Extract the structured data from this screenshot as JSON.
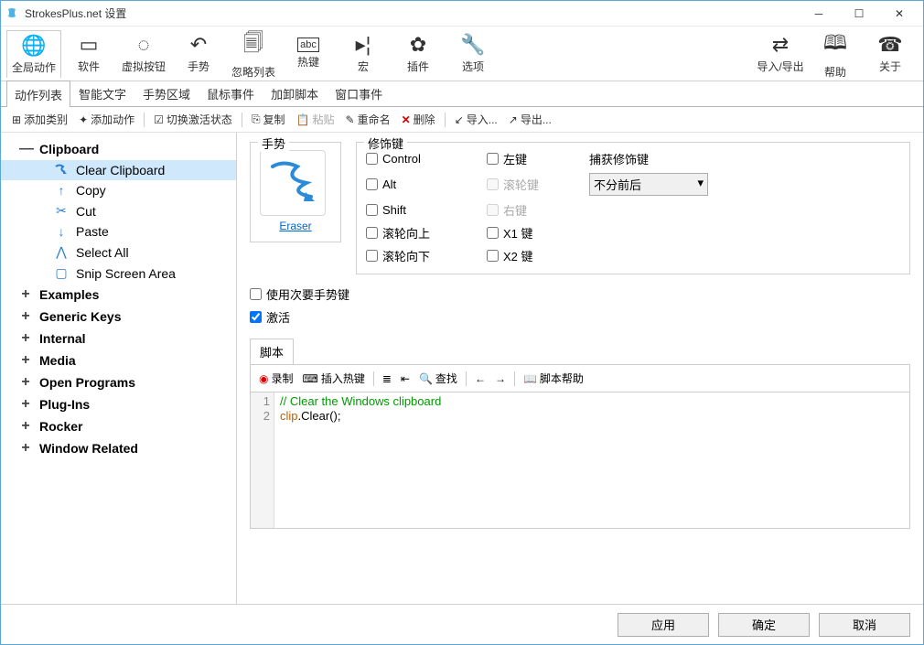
{
  "title": "StrokesPlus.net 设置",
  "toolbar": [
    {
      "icon": "🌐",
      "label": "全局动作"
    },
    {
      "icon": "▭",
      "label": "软件"
    },
    {
      "icon": "◌",
      "label": "虚拟按钮"
    },
    {
      "icon": "↶",
      "label": "手势"
    },
    {
      "icon": "🗐",
      "label": "忽略列表"
    },
    {
      "icon": "abc",
      "label": "热键"
    },
    {
      "icon": "▸|",
      "label": "宏"
    },
    {
      "icon": "⚙",
      "label": "插件"
    },
    {
      "icon": "🔧",
      "label": "选项"
    }
  ],
  "toolbar_right": [
    {
      "icon": "⇄",
      "label": "导入/导出"
    },
    {
      "icon": "?",
      "label": "帮助"
    },
    {
      "icon": "☎",
      "label": "关于"
    }
  ],
  "tabs": [
    "动作列表",
    "智能文字",
    "手势区域",
    "鼠标事件",
    "加卸脚本",
    "窗口事件"
  ],
  "subtoolbar": {
    "add_category": "添加类别",
    "add_action": "添加动作",
    "toggle_state": "切换激活状态",
    "copy": "复制",
    "paste": "粘贴",
    "rename": "重命名",
    "delete": "删除",
    "import": "导入...",
    "export": "导出..."
  },
  "tree": [
    {
      "type": "cat",
      "label": "Clipboard",
      "expanded": true,
      "children": [
        {
          "label": "Clear Clipboard",
          "selected": true
        },
        {
          "label": "Copy"
        },
        {
          "label": "Cut"
        },
        {
          "label": "Paste"
        },
        {
          "label": "Select All"
        },
        {
          "label": "Snip Screen Area"
        }
      ]
    },
    {
      "type": "cat",
      "label": "Examples"
    },
    {
      "type": "cat",
      "label": "Generic Keys"
    },
    {
      "type": "cat",
      "label": "Internal"
    },
    {
      "type": "cat",
      "label": "Media"
    },
    {
      "type": "cat",
      "label": "Open Programs"
    },
    {
      "type": "cat",
      "label": "Plug-Ins"
    },
    {
      "type": "cat",
      "label": "Rocker"
    },
    {
      "type": "cat",
      "label": "Window Related"
    }
  ],
  "gesture": {
    "legend": "手势",
    "link": "Eraser"
  },
  "modifiers": {
    "legend": "修饰键",
    "control": "Control",
    "alt": "Alt",
    "shift": "Shift",
    "wheelup": "滚轮向上",
    "wheeldown": "滚轮向下",
    "left": "左键",
    "wheel": "滚轮键",
    "right": "右键",
    "x1": "X1 键",
    "x2": "X2 键",
    "capture_label": "捕获修饰键",
    "capture_value": "不分前后"
  },
  "options": {
    "secondary": "使用次要手势键",
    "activate": "激活"
  },
  "script": {
    "tab": "脚本",
    "record": "录制",
    "insert_hotkey": "插入热键",
    "find": "查找",
    "help": "脚本帮助",
    "lines": [
      "// Clear the Windows clipboard",
      "clip.Clear();"
    ]
  },
  "footer": {
    "apply": "应用",
    "ok": "确定",
    "cancel": "取消"
  }
}
